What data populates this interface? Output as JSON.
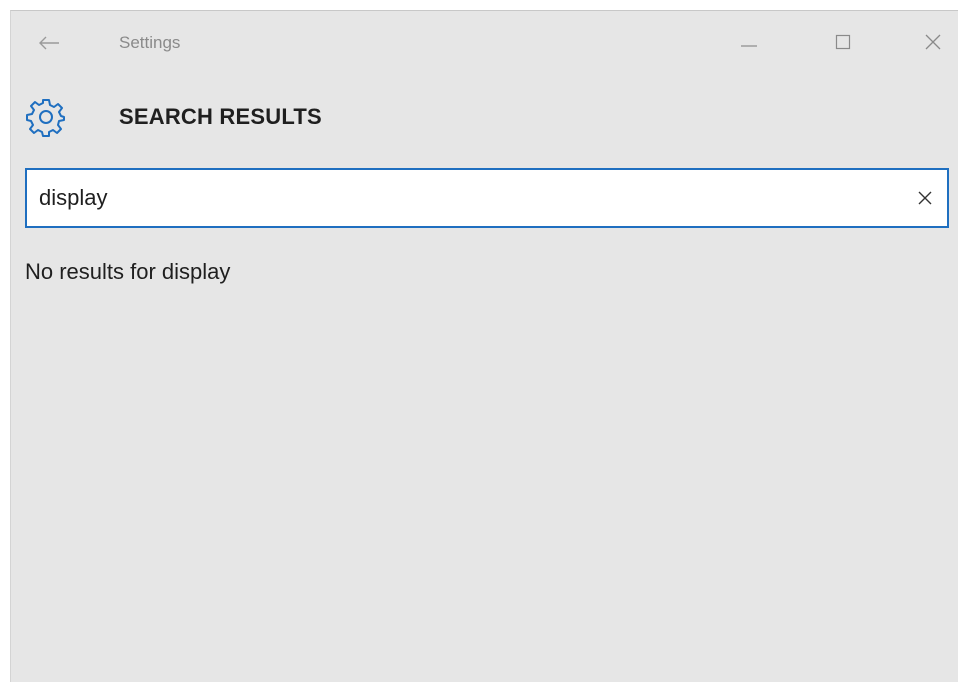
{
  "window": {
    "title": "Settings",
    "controls": [
      "minimize",
      "maximize",
      "close"
    ]
  },
  "icons": {
    "back": "back-arrow-icon",
    "gear": "gear-icon",
    "minimize": "minimize-icon",
    "maximize": "maximize-icon",
    "close": "close-icon",
    "clear": "clear-icon"
  },
  "header": {
    "title": "SEARCH RESULTS"
  },
  "search": {
    "value": "display",
    "placeholder": ""
  },
  "results": {
    "message": "No results for display"
  },
  "colors": {
    "accent": "#1f6fc0",
    "background": "#e6e6e6",
    "text": "#1f1f1f",
    "muted": "#8a8a8a"
  }
}
